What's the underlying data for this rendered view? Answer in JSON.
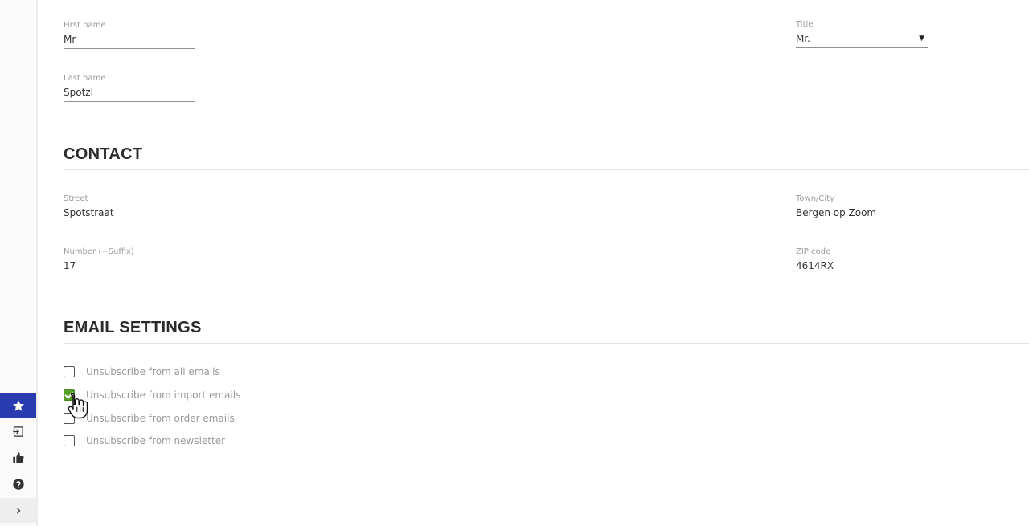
{
  "personal": {
    "first_name": {
      "label": "First name",
      "value": "Mr"
    },
    "last_name": {
      "label": "Last name",
      "value": "Spotzi"
    },
    "title": {
      "label": "Title",
      "value": "Mr."
    }
  },
  "contact": {
    "heading": "CONTACT",
    "street": {
      "label": "Street",
      "value": "Spotstraat"
    },
    "number": {
      "label": "Number (+Suffix)",
      "value": "17"
    },
    "town": {
      "label": "Town/City",
      "value": "Bergen op Zoom"
    },
    "zip": {
      "label": "ZIP code",
      "value": "4614RX"
    }
  },
  "email_settings": {
    "heading": "EMAIL SETTINGS",
    "options": [
      {
        "label": "Unsubscribe from all emails",
        "checked": false
      },
      {
        "label": "Unsubscribe from import emails",
        "checked": true
      },
      {
        "label": "Unsubscribe from order emails",
        "checked": false
      },
      {
        "label": "Unsubscribe from newsletter",
        "checked": false
      }
    ]
  },
  "sidebar": {
    "icons": [
      "star-icon",
      "sign-in-icon",
      "thumbs-up-icon",
      "help-icon",
      "chevron-right-icon"
    ],
    "active_color": "#2a3bb0"
  },
  "colors": {
    "checkbox_checked": "#5aa02c"
  }
}
